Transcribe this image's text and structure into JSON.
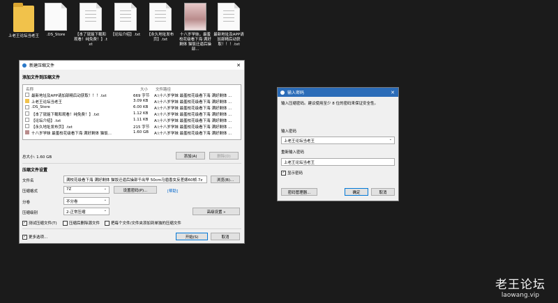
{
  "desktop": {
    "icons": [
      {
        "label": "上老王论坛当老王",
        "type": "folder"
      },
      {
        "label": ".DS_Store",
        "type": "file"
      },
      {
        "label": "【本了就能下载和观看！纯免费！】.txt",
        "type": "file"
      },
      {
        "label": "【论坛介绍】.txt",
        "type": "file"
      },
      {
        "label": "【永久地址发布页】.txt",
        "type": "file"
      },
      {
        "label": "十八岁学妹，最羞校花级看下海 满好剩体 猫饭迁逼后操部...",
        "type": "image"
      },
      {
        "label": "最新地址及APP请加部精后动获取！！！.txt",
        "type": "file"
      }
    ]
  },
  "archive_dialog": {
    "title": "新建压缩文件",
    "section_add": "添加文件到压缩文件",
    "columns": {
      "name": "名称",
      "size": "大小",
      "path": "文件路径"
    },
    "files": [
      {
        "name": "最新地址及APP请加部精后动获取！！！.txt",
        "size": "669 字节",
        "path": "A:\\十八岁学妹 最羞校花级看下海 满好剩体 ...",
        "icon": "file"
      },
      {
        "name": "上老王论坛当老王",
        "size": "3.09 KB",
        "path": "A:\\十八岁学妹 最羞校花级看下海 满好剩体 ...",
        "icon": "folder"
      },
      {
        "name": ".DS_Store",
        "size": "6.00 KB",
        "path": "A:\\十八岁学妹 最羞校花级看下海 满好剩体 ...",
        "icon": "file"
      },
      {
        "name": "【本了就能下载和观看！纯免费！】.txt",
        "size": "1.12 KB",
        "path": "A:\\十八岁学妹 最羞校花级看下海 满好剩体 ...",
        "icon": "file"
      },
      {
        "name": "【论坛介绍】.txt",
        "size": "1.11 KB",
        "path": "A:\\十八岁学妹 最羞校花级看下海 满好剩体 ...",
        "icon": "file"
      },
      {
        "name": "【永久地址发布页】.txt",
        "size": "215 字节",
        "path": "A:\\十八岁学妹 最羞校花级看下海 满好剩体 ...",
        "icon": "file"
      },
      {
        "name": "十八岁学妹 最羞校花级看下海 满好剩体 猫饭...",
        "size": "1.60 GB",
        "path": "A:\\十八岁学妹 最羞校花级看下海 满好剩体 ...",
        "icon": "image"
      }
    ],
    "total_size": "总大小: 1.60 GB",
    "add_button": "添加(A)",
    "delete_button": "删除(D)",
    "section_settings": "压缩文件设置",
    "filename_label": "文件名",
    "filename_value": "满校花级看下海 满好剩体 猫饭迁逼后操部千出早 50cm马眉香女反差婊60帧.7z",
    "browse_button": "浏览(B)...",
    "format_label": "压缩格式",
    "format_value": "7Z",
    "set_password_button": "设置密码(P)...",
    "help_link": "[帮助]",
    "split_label": "分卷",
    "split_value": "不分卷",
    "level_label": "压缩级别",
    "level_value": "2-正常压缩",
    "advanced_button": "高级设置 »",
    "test_archive": "测试压缩文件(T)",
    "delete_source": "压缩后删除源文件",
    "each_separately": "把每个文件/文件夹添加到单独的压缩文件",
    "more_options": "更多选项...",
    "start_button": "开始(S)",
    "cancel_button": "取消"
  },
  "password_dialog": {
    "title": "输入密码",
    "hint": "输入压缩密码。建议使用至少 8 位的密码来保证安全性。",
    "enter_label": "输入密码",
    "enter_value": "上老王论坛当老王",
    "reenter_label": "重新输入密码",
    "reenter_value": "上老王论坛当老王",
    "show_password": "显示密码",
    "manager_button": "密码管理器...",
    "ok_button": "确定",
    "cancel_button": "取消"
  },
  "watermark": {
    "title": "老王论坛",
    "url": "laowang.vip"
  }
}
